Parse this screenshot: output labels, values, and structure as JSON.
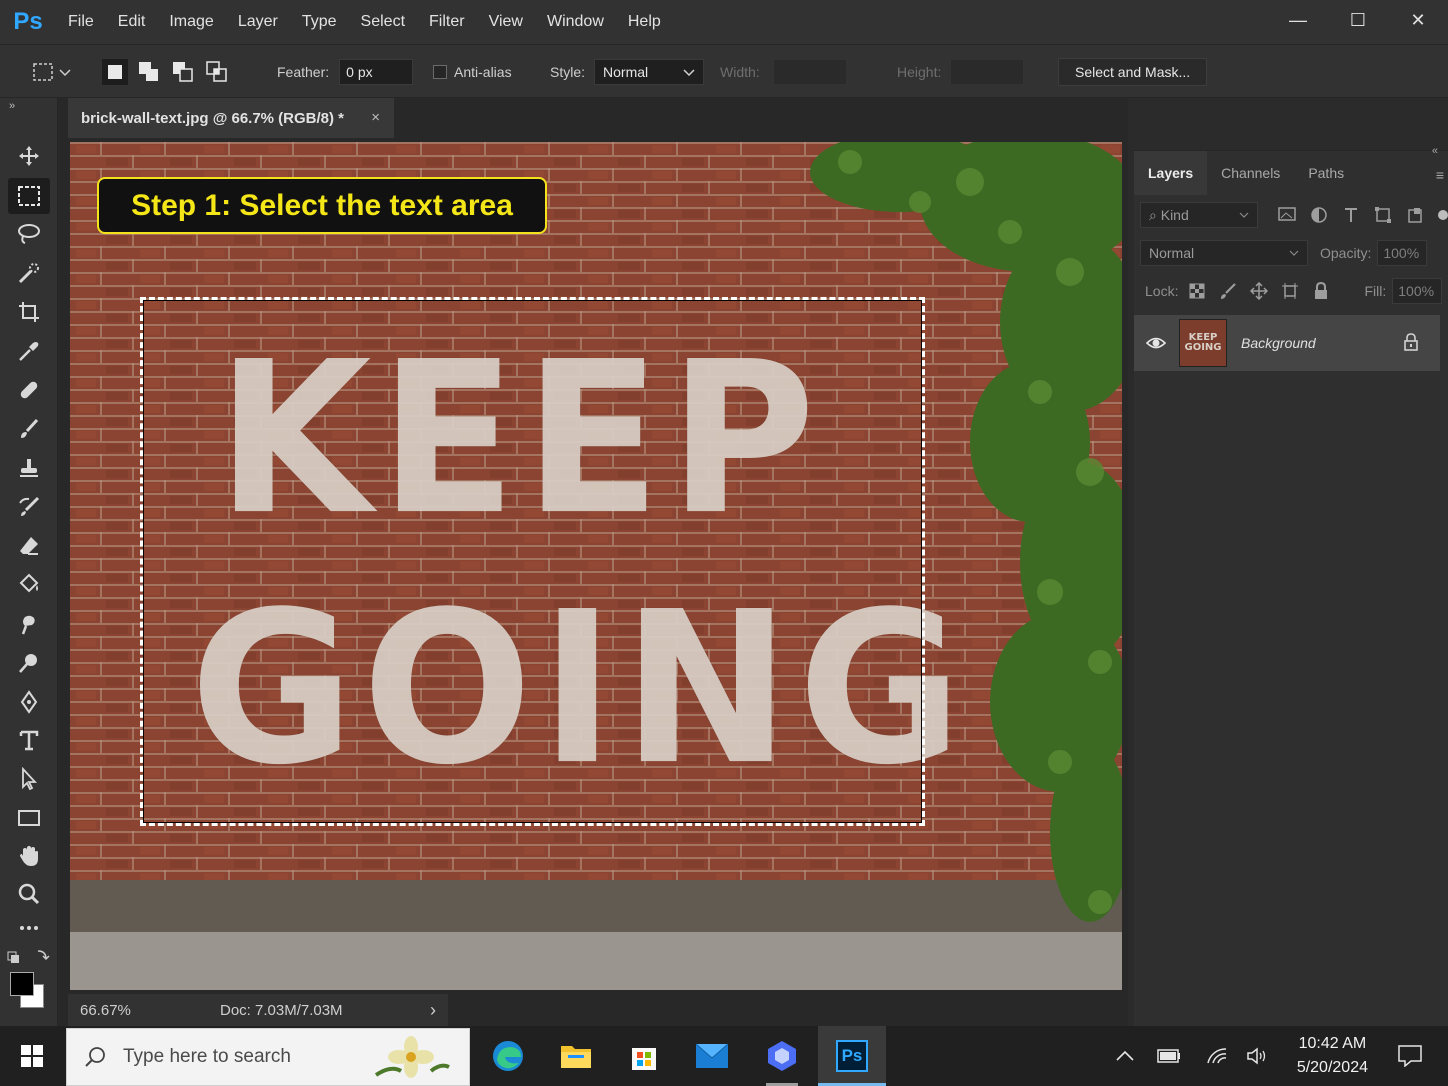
{
  "app": {
    "logo": "Ps"
  },
  "menu": [
    "File",
    "Edit",
    "Image",
    "Layer",
    "Type",
    "Select",
    "Filter",
    "View",
    "Window",
    "Help"
  ],
  "window_controls": {
    "minimize": "—",
    "maximize": "☐",
    "close": "✕"
  },
  "options": {
    "feather_label": "Feather:",
    "feather_value": "0 px",
    "antialias_label": "Anti-alias",
    "style_label": "Style:",
    "style_value": "Normal",
    "width_label": "Width:",
    "height_label": "Height:",
    "select_mask_label": "Select and Mask..."
  },
  "document": {
    "tab_title": "brick-wall-text.jpg @ 66.7% (RGB/8) *",
    "tab_close": "×",
    "callout": "Step 1: Select the text area",
    "wall_text_line1": "KEEP",
    "wall_text_line2": "GOING"
  },
  "status": {
    "zoom": "66.67%",
    "doc": "Doc: 7.03M/7.03M",
    "arrow": "›"
  },
  "layers_panel": {
    "tabs": [
      "Layers",
      "Channels",
      "Paths"
    ],
    "kind_label": "Kind",
    "blend_mode": "Normal",
    "opacity_label": "Opacity:",
    "opacity_value": "100%",
    "lock_label": "Lock:",
    "fill_label": "Fill:",
    "fill_value": "100%",
    "layer_name": "Background",
    "thumb_text": "KEEP GOING"
  },
  "taskbar": {
    "search_placeholder": "Type here to search",
    "time": "10:42 AM",
    "date": "5/20/2024",
    "ps_label": "Ps"
  },
  "colors": {
    "accent": "#31a8ff",
    "callout_text": "#f5e618",
    "brick": "#8a4330",
    "ivy": "#3f6a24"
  }
}
